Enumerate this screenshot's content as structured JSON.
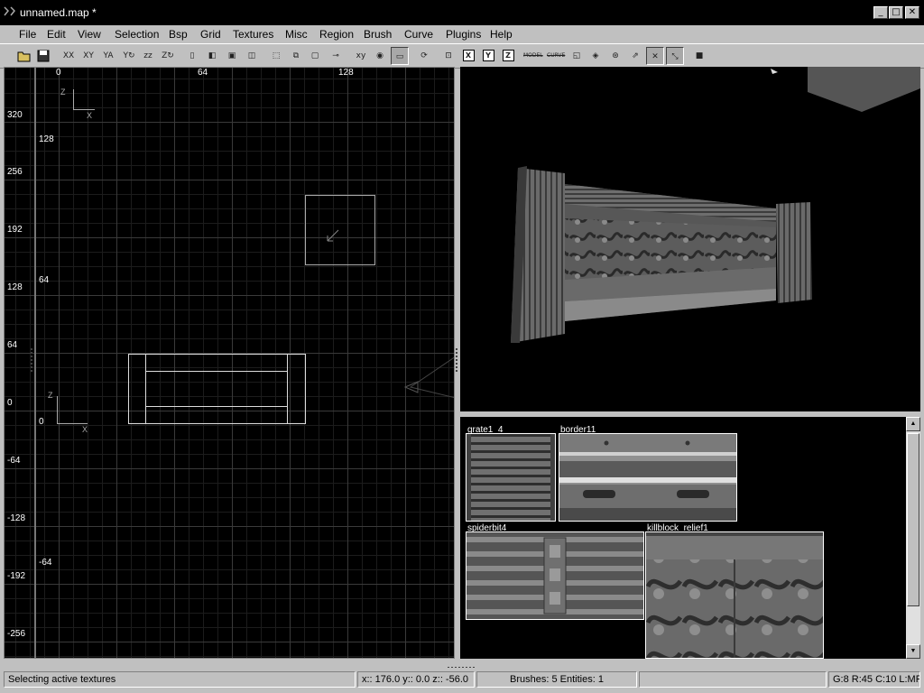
{
  "window": {
    "title": "unnamed.map *",
    "controls": {
      "minimize": "_",
      "maximize": "□",
      "close": "✕"
    }
  },
  "menu": [
    "File",
    "Edit",
    "View",
    "Selection",
    "Bsp",
    "Grid",
    "Textures",
    "Misc",
    "Region",
    "Brush",
    "Curve",
    "Plugins",
    "Help"
  ],
  "toolbar": {
    "letter_buttons": [
      "X",
      "Y",
      "Z"
    ],
    "icons": [
      "open-icon",
      "save-icon",
      "flip-x-icon",
      "flip-y-icon",
      "flip-z-icon",
      "rotate-x-icon",
      "rotate-y-icon",
      "rotate-z-icon",
      "csg-subtract-icon",
      "csg-merge-icon",
      "hollow-icon",
      "clipper-icon",
      "change-view-icon",
      "texture-lock-icon",
      "camera-icon",
      "camera-movement-icon",
      "select-touching-icon",
      "select-partial-icon",
      "select-inside-icon",
      "select-complete-icon",
      "patch-bend-icon",
      "patch-insert-icon",
      "patch-delete-icon",
      "cap-icon",
      "scale-icon",
      "dont-select-model-icon",
      "dont-select-curve-icon",
      "show-patch-bounding-icon",
      "patch-wireframe-icon",
      "patch-badmap-icon",
      "patch-weld-icon",
      "patch-drill-icon",
      "free-rotation-icon",
      "free-scale-icon",
      "cubic-clip-icon"
    ],
    "tag_model": "MODEL",
    "tag_curve": "CURVE"
  },
  "view2d": {
    "top_ruler": [
      "0",
      "64",
      "128"
    ],
    "left_ruler": [
      "320",
      "256",
      "192",
      "128",
      "64",
      "0",
      "-64",
      "-128",
      "-192",
      "-256"
    ],
    "inner_y_labels": [
      "128",
      "64",
      "0",
      "-64"
    ],
    "axis_top": {
      "vertical": "Z",
      "horizontal": "X"
    },
    "axis_origin": {
      "vertical": "Z",
      "horizontal": "X"
    }
  },
  "textures": [
    {
      "name": "grate1_4"
    },
    {
      "name": "border11"
    },
    {
      "name": "spiderbit4"
    },
    {
      "name": "killblock_relief1"
    }
  ],
  "status": {
    "message": "Selecting active textures",
    "coords": "x:: 176.0  y:: 0.0  z:: -56.0",
    "counts": "Brushes: 5 Entities: 1",
    "grid": "G:8 R:45 C:10 L:MR"
  }
}
